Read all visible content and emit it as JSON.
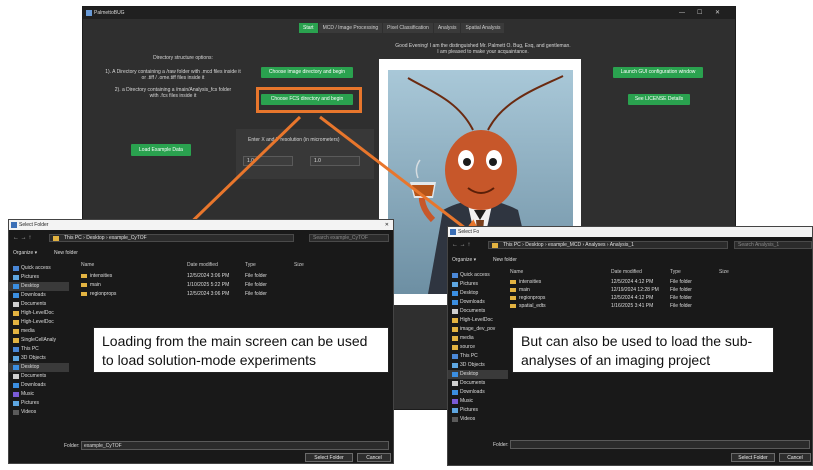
{
  "app": {
    "title": "PalmettoBUG",
    "win_controls": [
      "—",
      "☐",
      "✕"
    ],
    "tabs": [
      "Start",
      "MCD / Image Processing",
      "Pixel Classification",
      "Analysis",
      "Spatial Analysis"
    ],
    "directory_options_title": "Directory structure options:",
    "option_1a": "1). A Directory containing a /raw folder with .mcd files inside it",
    "option_1b": "or .tiff / .ome.tiff files inside it",
    "option_2a": "2). a Directory containing a /main/Analysis_fcs folder",
    "option_2b": "with .fcs files inside it",
    "btn_choose_image_dir": "Choose image directory and begin",
    "btn_choose_fcs_dir": "Choose FCS directory and begin",
    "btn_launch_gui": "Launch GUI configuration window",
    "btn_license": "See LICENSE Details",
    "btn_load_example": "Load Example Data",
    "greeting_1": "Good Evening! I am the distinguished Mr. Palmett O. Bug, Esq, and gentleman.",
    "greeting_2": "I am pleased to make your acquaintance.",
    "resolution_label": "Enter X and Y resolution (in micrometers)",
    "res_x": "1.0",
    "res_y": "1.0"
  },
  "dialog_left": {
    "title": "Select Folder",
    "breadcrumb": "This PC  ›  Desktop  ›  example_CyTOF",
    "search_placeholder": "Search example_CyTOF",
    "organize": "Organize ▾",
    "new_folder": "New folder",
    "columns": [
      "Name",
      "Date modified",
      "Type",
      "Size"
    ],
    "rows": [
      {
        "name": "intensities",
        "date": "12/5/2024 3:06 PM",
        "type": "File folder"
      },
      {
        "name": "main",
        "date": "1/10/2025 5:22 PM",
        "type": "File folder"
      },
      {
        "name": "regionprops",
        "date": "12/5/2024 3:06 PM",
        "type": "File folder"
      }
    ],
    "nav": [
      "Quick access",
      "Pictures",
      "Desktop",
      "Downloads",
      "Documents",
      "High-LevelDoc",
      "High-LevelDoc",
      "media",
      "SingleCellAnaly",
      "This PC",
      "3D Objects",
      "Desktop",
      "Documents",
      "Downloads",
      "Music",
      "Pictures",
      "Videos"
    ],
    "folder_label": "Folder:",
    "folder_value": "example_CyTOF",
    "btn_select": "Select Folder",
    "btn_cancel": "Cancel"
  },
  "dialog_right": {
    "title": "Select Fo",
    "breadcrumb": "This PC  ›  Desktop  ›  example_MCD  ›  Analyses  ›  Analysis_1",
    "search_placeholder": "Search Analysis_1",
    "organize": "Organize ▾",
    "new_folder": "New folder",
    "columns": [
      "Name",
      "Date modified",
      "Type",
      "Size"
    ],
    "rows": [
      {
        "name": "intensities",
        "date": "12/5/2024 4:12 PM",
        "type": "File folder"
      },
      {
        "name": "main",
        "date": "12/19/2024 12:28 PM",
        "type": "File folder"
      },
      {
        "name": "regionprops",
        "date": "12/5/2024 4:12 PM",
        "type": "File folder"
      },
      {
        "name": "spatial_edts",
        "date": "1/16/2025 3:41 PM",
        "type": "File folder"
      }
    ],
    "nav": [
      "Quick access",
      "Pictures",
      "Desktop",
      "Downloads",
      "Documents",
      "High-LevelDoc",
      "image_dev_pov",
      "media",
      "source",
      "This PC",
      "3D Objects",
      "Desktop",
      "Documents",
      "Downloads",
      "Music",
      "Pictures",
      "Videos"
    ],
    "folder_label": "Folder:",
    "folder_value": "",
    "btn_select": "Select Folder",
    "btn_cancel": "Cancel"
  },
  "callouts": {
    "left": "Loading from the main screen can be used to load solution-mode experiments",
    "right": "But can also be used to load the sub-analyses of an imaging project"
  },
  "colors": {
    "accent": "#2aa24f",
    "annotation": "#e8762c",
    "folder": "#e3b341"
  }
}
